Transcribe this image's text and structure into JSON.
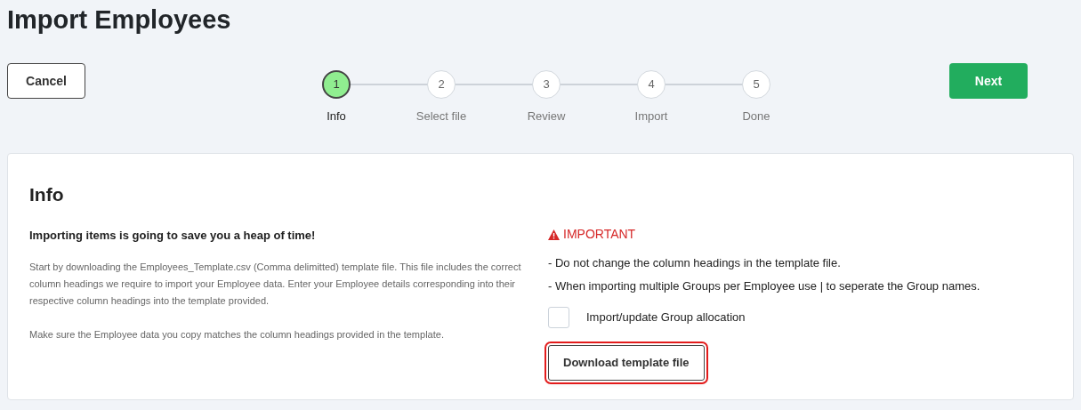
{
  "page_title": "Import Employees",
  "cancel_button": "Cancel",
  "next_button": "Next",
  "steps": [
    {
      "number": "1",
      "label": "Info",
      "selected": true
    },
    {
      "number": "2",
      "label": "Select file",
      "selected": false
    },
    {
      "number": "3",
      "label": "Review",
      "selected": false
    },
    {
      "number": "4",
      "label": "Import",
      "selected": false
    },
    {
      "number": "5",
      "label": "Done",
      "selected": false
    }
  ],
  "card": {
    "title": "Info",
    "lead": "Importing items is going to save you a heap of time!",
    "paragraphs": [
      "Start by downloading the Employees_Template.csv (Comma delimitted) template file. This file includes the correct column headings we require to import your Employee data. Enter your Employee details corresponding into their respective column headings into the template provided.",
      "Make sure the Employee data you copy matches the column headings provided in the template."
    ],
    "important_label": "IMPORTANT",
    "notes": [
      "- Do not change the column headings in the template file.",
      "- When importing multiple Groups per Employee use | to seperate the Group names."
    ],
    "checkbox": {
      "label": "Import/update Group allocation",
      "checked": false
    },
    "download_button": {
      "label": "Download template file",
      "focused": true
    }
  }
}
